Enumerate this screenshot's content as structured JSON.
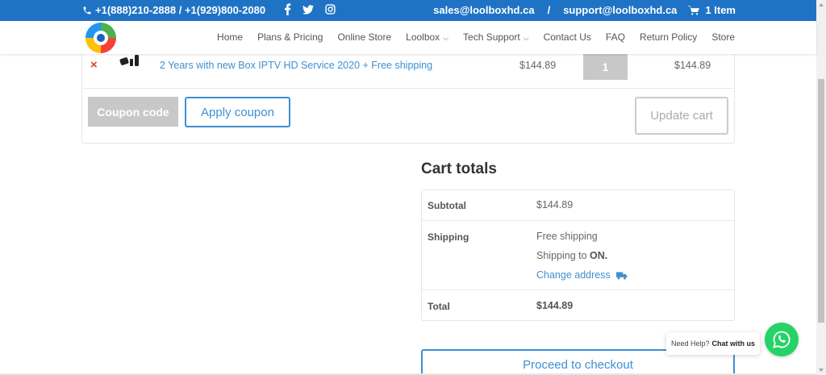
{
  "topbar": {
    "phone": "+1(888)210-2888 / +1(929)800-2080",
    "social_icons": [
      "facebook-icon",
      "twitter-icon",
      "instagram-icon"
    ],
    "email_sales": "sales@loolboxhd.ca",
    "separator": "/",
    "email_support": "support@loolboxhd.ca",
    "cart_label": "1 Item",
    "bg_color": "#1f73c5"
  },
  "nav": {
    "items": [
      {
        "label": "Home"
      },
      {
        "label": "Plans & Pricing"
      },
      {
        "label": "Online Store"
      },
      {
        "label": "Loolbox",
        "dropdown": true
      },
      {
        "label": "Tech Support",
        "dropdown": true
      },
      {
        "label": "Contact Us"
      },
      {
        "label": "FAQ"
      },
      {
        "label": "Return Policy"
      },
      {
        "label": "Store"
      }
    ]
  },
  "cart": {
    "remove_symbol": "×",
    "product_name": "2 Years with new Box IPTV HD Service 2020 + Free shipping",
    "price": "$144.89",
    "quantity": "1",
    "subtotal": "$144.89",
    "coupon_placeholder": "Coupon code",
    "apply_coupon_label": "Apply coupon",
    "update_cart_label": "Update cart"
  },
  "totals": {
    "title": "Cart totals",
    "subtotal_label": "Subtotal",
    "subtotal_value": "$144.89",
    "shipping_label": "Shipping",
    "shipping_method": "Free shipping",
    "shipping_to_prefix": "Shipping to ",
    "shipping_to_region": "ON",
    "shipping_to_suffix": ".",
    "change_address": "Change address",
    "total_label": "Total",
    "total_value": "$144.89",
    "checkout_label": "Proceed to checkout"
  },
  "help": {
    "prefix": "Need Help?",
    "cta": "Chat with us"
  },
  "colors": {
    "accent": "#3e8fd3",
    "remove": "#e2401c",
    "whatsapp": "#25d366"
  }
}
